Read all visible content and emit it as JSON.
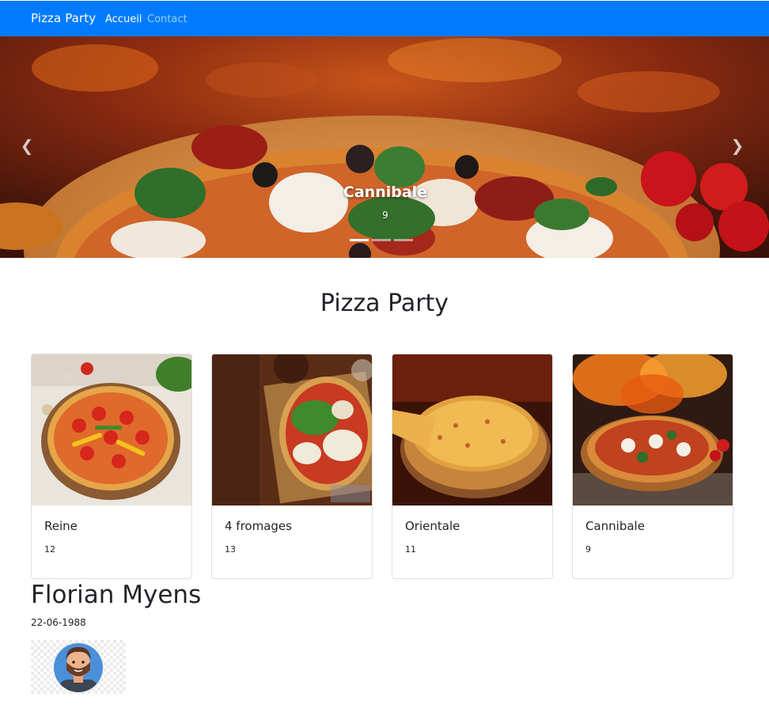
{
  "navbar": {
    "brand": "Pizza Party",
    "links": [
      {
        "label": "Accueil",
        "active": true
      },
      {
        "label": "Contact",
        "active": false
      }
    ],
    "background": "#007bff"
  },
  "carousel": {
    "caption_title": "Cannibale",
    "caption_text": "9",
    "active_slide": 1,
    "slide_count": 3,
    "prev_icon": "chevron-left-icon",
    "next_icon": "chevron-right-icon"
  },
  "page": {
    "title": "Pizza Party"
  },
  "pizzas": [
    {
      "name": "Reine",
      "price": "12"
    },
    {
      "name": "4 fromages",
      "price": "13"
    },
    {
      "name": "Orientale",
      "price": "11"
    },
    {
      "name": "Cannibale",
      "price": "9"
    }
  ],
  "profile": {
    "name": "Florian Myens",
    "birthdate": "22-06-1988"
  }
}
